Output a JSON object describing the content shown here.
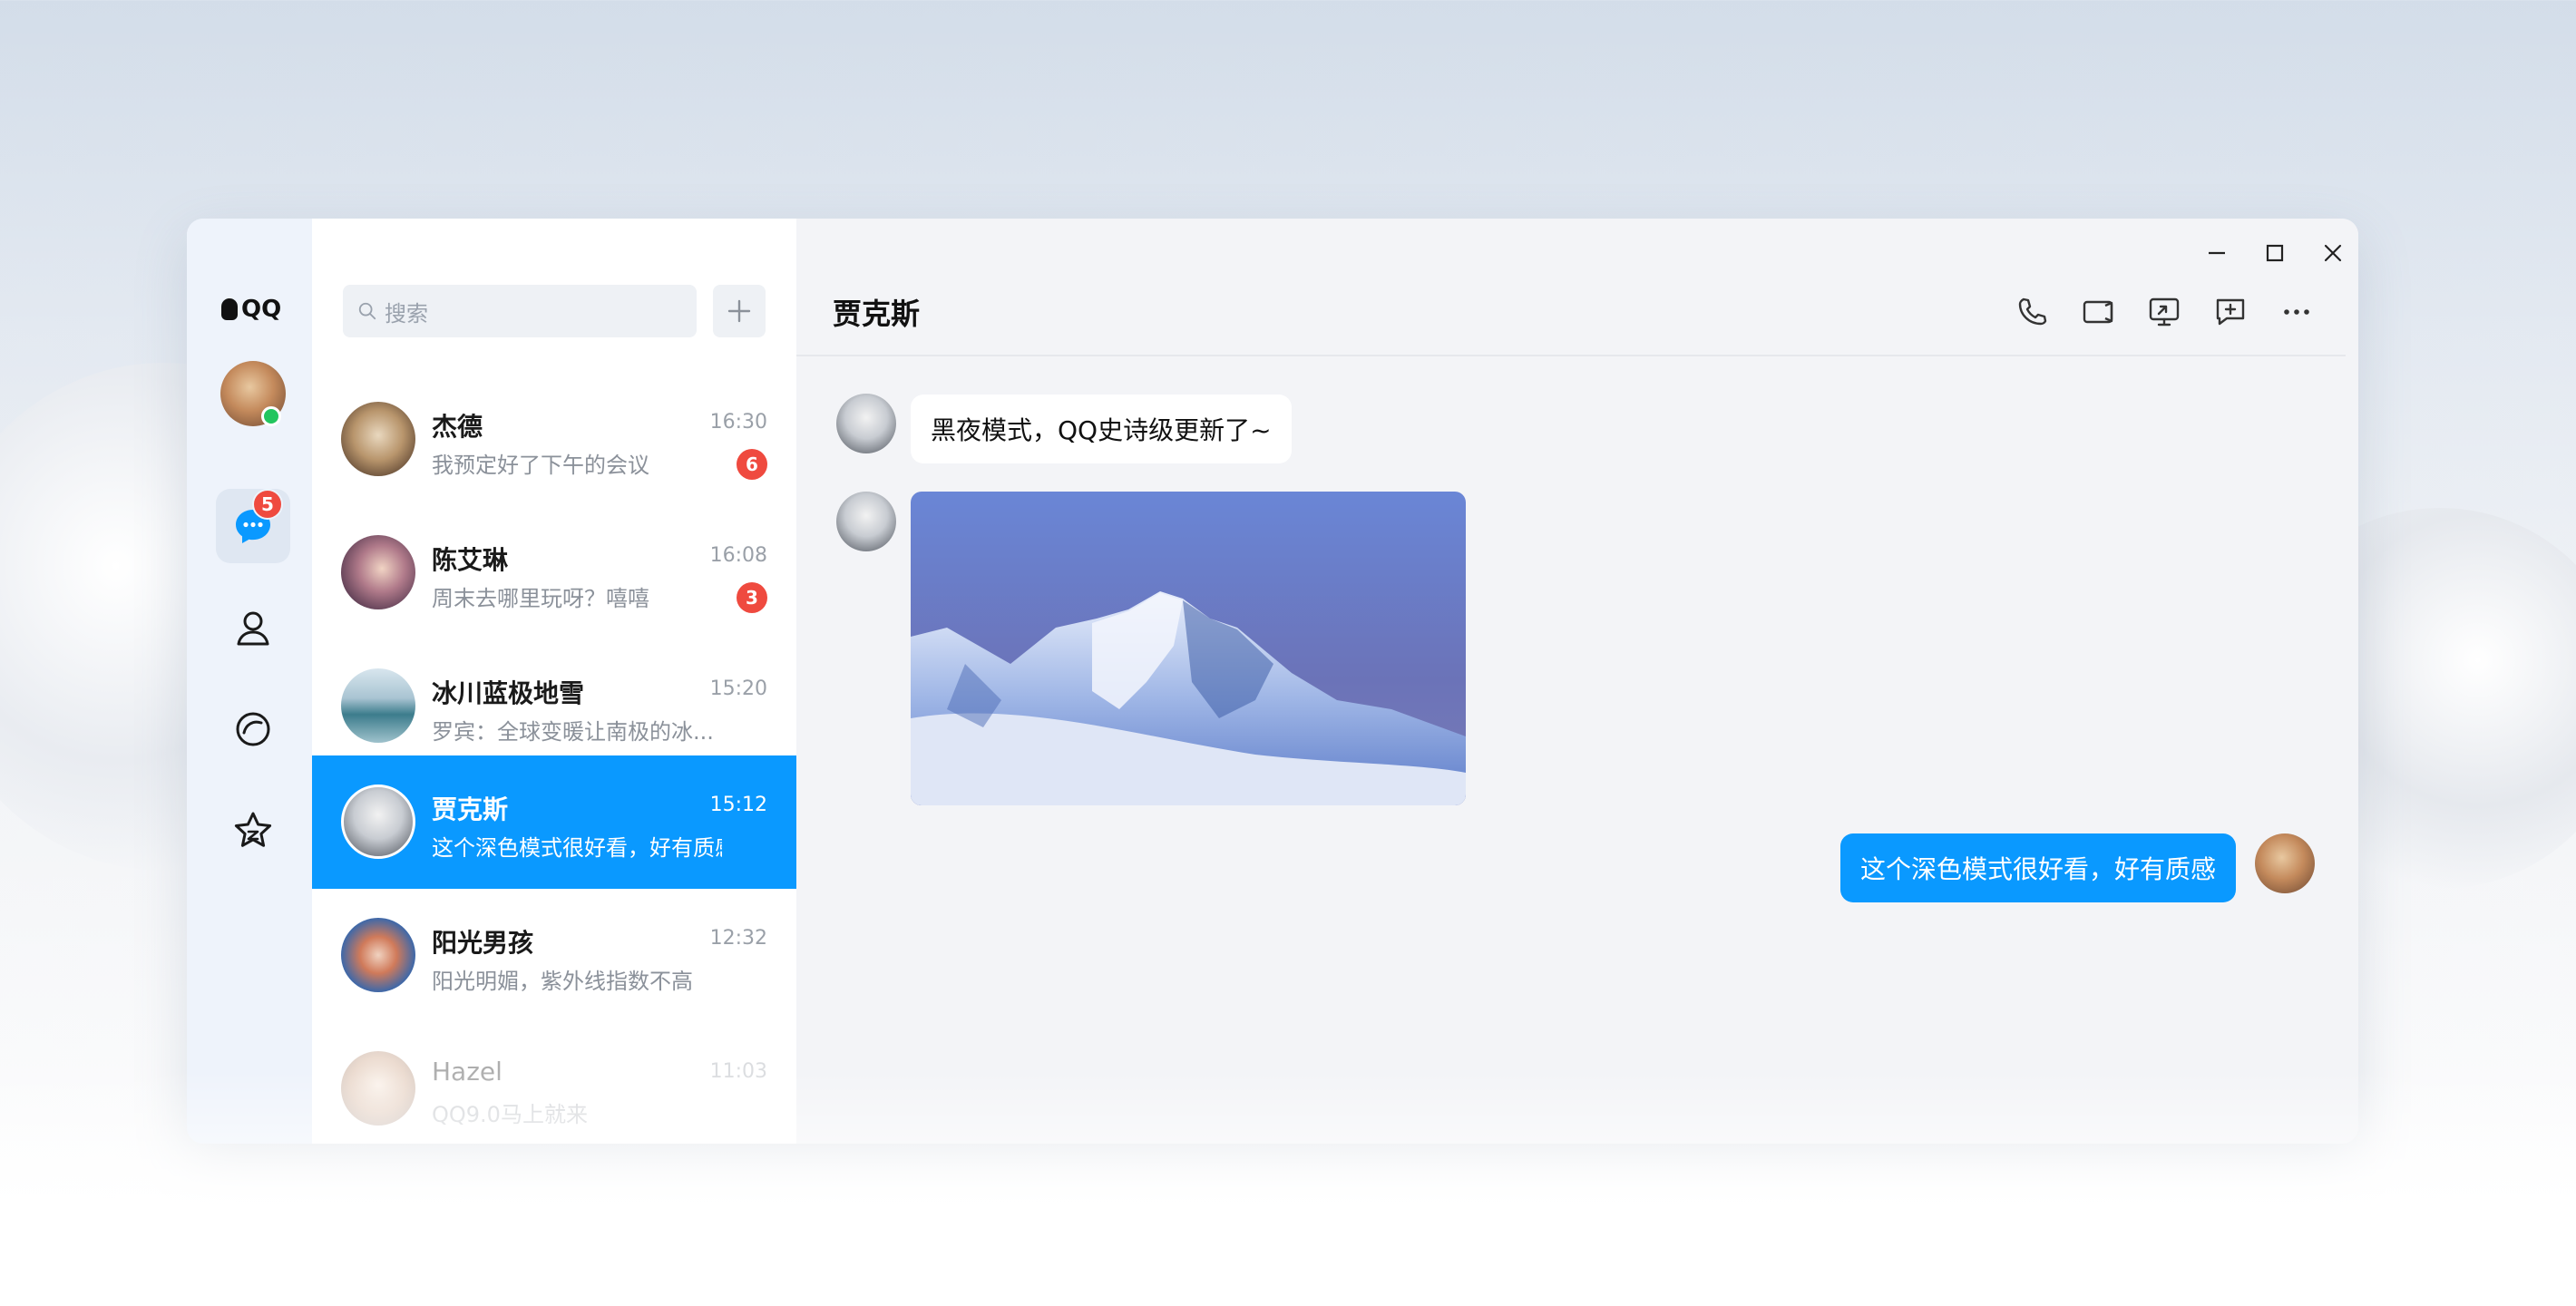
{
  "app": {
    "logo_text": "QQ"
  },
  "rail": {
    "chat_badge": "5"
  },
  "search": {
    "placeholder": "搜索"
  },
  "conversations": [
    {
      "name": "杰德",
      "time": "16:30",
      "message": "我预定好了下午的会议",
      "badge": "6"
    },
    {
      "name": "陈艾琳",
      "time": "16:08",
      "message": "周末去哪里玩呀？嘻嘻",
      "badge": "3"
    },
    {
      "name": "冰川蓝极地雪",
      "time": "15:20",
      "message": "罗宾：全球变暖让南极的冰..."
    },
    {
      "name": "贾克斯",
      "time": "15:12",
      "message": "这个深色模式很好看，好有质感"
    },
    {
      "name": "阳光男孩",
      "time": "12:32",
      "message": "阳光明媚，紫外线指数不高"
    },
    {
      "name": "Hazel",
      "time": "11:03",
      "message": "QQ9.0马上就来"
    }
  ],
  "chat": {
    "title": "贾克斯",
    "messages": [
      {
        "direction": "in",
        "type": "text",
        "text": "黑夜模式，QQ史诗级更新了~"
      },
      {
        "direction": "in",
        "type": "image",
        "image": "snowy-mountain-photo"
      },
      {
        "direction": "out",
        "type": "text",
        "text": "这个深色模式很好看，好有质感"
      }
    ]
  },
  "colors": {
    "accent": "#0a99ff",
    "badge": "#ef4a3f",
    "online": "#22c55e"
  }
}
